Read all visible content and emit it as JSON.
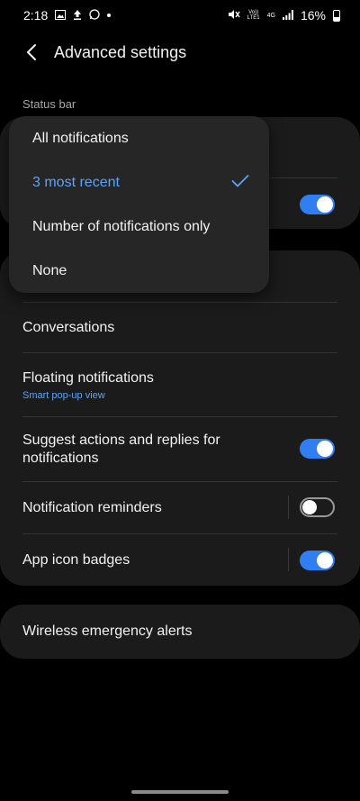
{
  "status_bar": {
    "time": "2:18",
    "network_label": "Vo)) LTE1",
    "network_type": "4G",
    "battery_percent": "16%"
  },
  "header": {
    "title": "Advanced settings"
  },
  "section": {
    "status_bar_label": "Status bar"
  },
  "dropdown": {
    "options": [
      {
        "label": "All notifications",
        "selected": false
      },
      {
        "label": "3 most recent",
        "selected": true
      },
      {
        "label": "Number of notifications only",
        "selected": false
      },
      {
        "label": "None",
        "selected": false
      }
    ]
  },
  "settings": [
    {
      "label": "Conversations"
    },
    {
      "label": "Floating notifications",
      "sublabel": "Smart pop-up view"
    },
    {
      "label": "Suggest actions and replies for notifications",
      "toggle": true
    },
    {
      "label": "Notification reminders",
      "toggle": false
    },
    {
      "label": "App icon badges",
      "toggle": true
    }
  ],
  "wireless": {
    "label": "Wireless emergency alerts"
  },
  "colors": {
    "accent": "#2f7ff2",
    "accent_text": "#5da3f6",
    "card": "#1b1b1b",
    "background": "#000000"
  }
}
